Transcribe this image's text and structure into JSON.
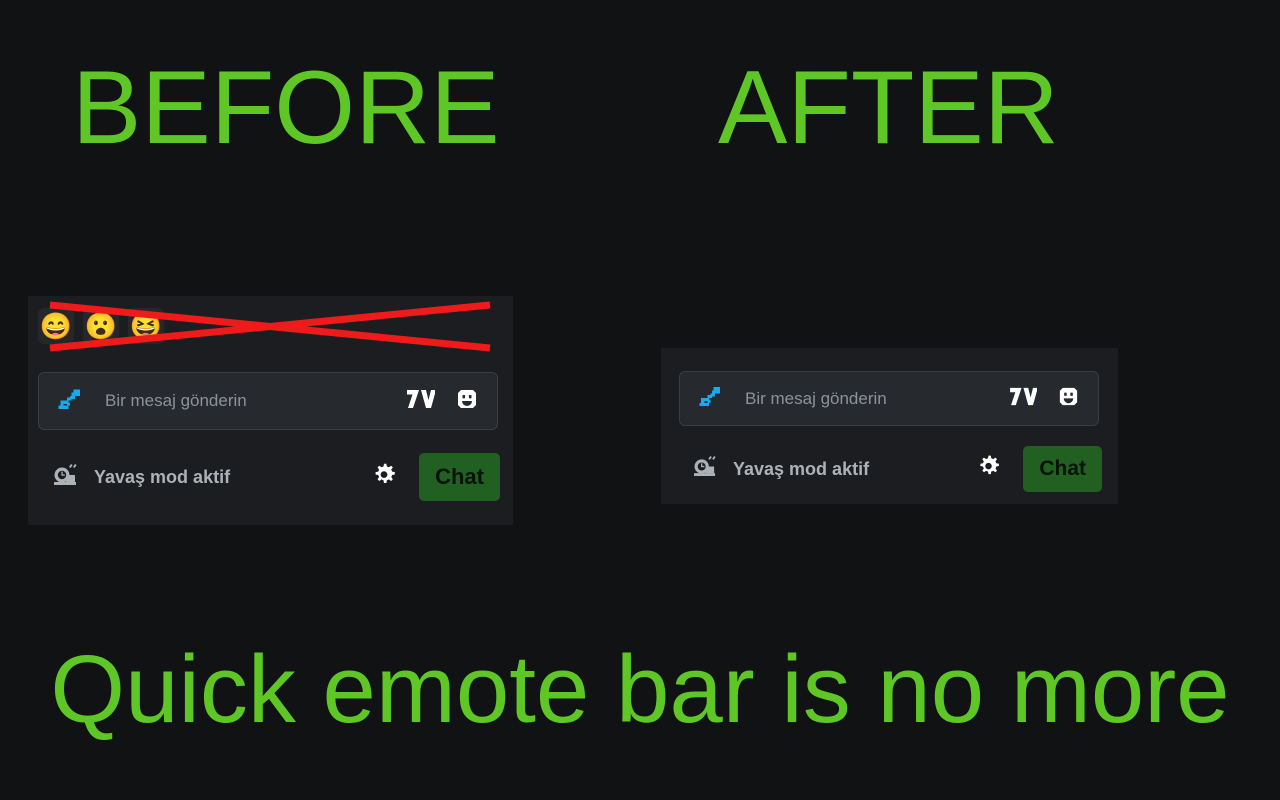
{
  "colors": {
    "page_background": "#101214",
    "panel_background": "#1c1d20",
    "input_background": "#26292e",
    "accent_green": "#5ec726",
    "chat_button_green": "#216020",
    "cross_out_red": "#ef1b1b",
    "placeholder_text": "#8d9299",
    "slowmode_text": "#adb2b9",
    "sword_blue": "#1aa9f0"
  },
  "headings": {
    "before": "BEFORE",
    "after": "AFTER"
  },
  "caption": "Quick emote bar is no more",
  "before_panel": {
    "quick_emote_bar": {
      "visible": true,
      "crossed_out": true,
      "emotes": [
        {
          "name": "emote-slot-1",
          "glyph": "😄"
        },
        {
          "name": "emote-slot-2",
          "glyph": "😮"
        },
        {
          "name": "emote-slot-3",
          "glyph": "😆"
        }
      ]
    },
    "message_input": {
      "placeholder": "Bir mesaj gönderin",
      "value": "",
      "left_icon": "sword-icon",
      "right_icons": [
        "seventv-icon",
        "emote-picker-icon"
      ]
    },
    "bottom_bar": {
      "slow_mode_icon": "snail-icon",
      "slow_mode_label": "Yavaş mod aktif",
      "settings_icon": "gear-icon",
      "chat_button_label": "Chat"
    }
  },
  "after_panel": {
    "quick_emote_bar": {
      "visible": false,
      "emotes": []
    },
    "message_input": {
      "placeholder": "Bir mesaj gönderin",
      "value": "",
      "left_icon": "sword-icon",
      "right_icons": [
        "seventv-icon",
        "emote-picker-icon"
      ]
    },
    "bottom_bar": {
      "slow_mode_icon": "snail-icon",
      "slow_mode_label": "Yavaş mod aktif",
      "settings_icon": "gear-icon",
      "chat_button_label": "Chat"
    }
  }
}
